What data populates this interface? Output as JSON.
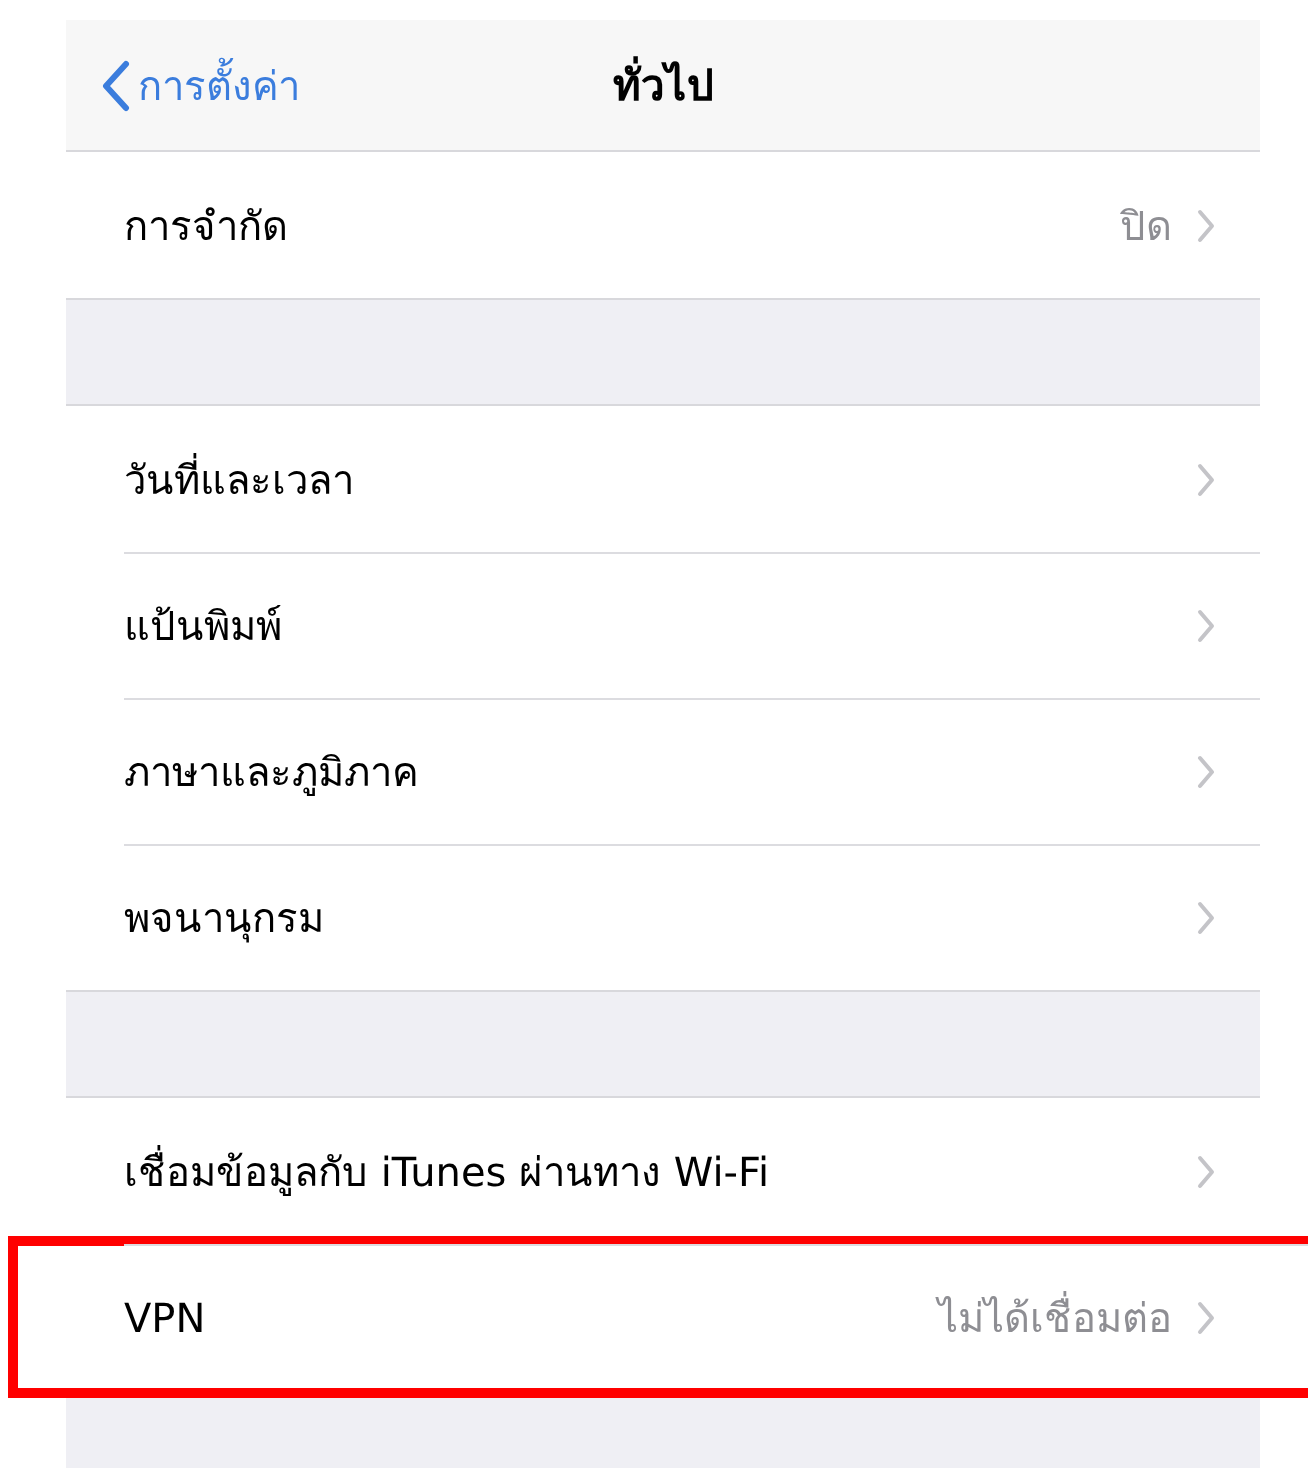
{
  "nav": {
    "back_label": "การตั้งค่า",
    "title": "ทั่วไป"
  },
  "sections": [
    {
      "rows": [
        {
          "label": "การจำกัด",
          "value": "ปิด",
          "highlighted": false
        }
      ]
    },
    {
      "rows": [
        {
          "label": "วันที่และเวลา",
          "highlighted": false
        },
        {
          "label": "แป้นพิมพ์",
          "highlighted": false
        },
        {
          "label": "ภาษาและภูมิภาค",
          "highlighted": false
        },
        {
          "label": "พจนานุกรม",
          "highlighted": false
        }
      ]
    },
    {
      "rows": [
        {
          "label": "เชื่อมข้อมูลกับ iTunes ผ่านทาง Wi-Fi",
          "highlighted": false
        },
        {
          "label": "VPN",
          "value": "ไม่ได้เชื่อมต่อ",
          "highlighted": true
        }
      ]
    }
  ]
}
